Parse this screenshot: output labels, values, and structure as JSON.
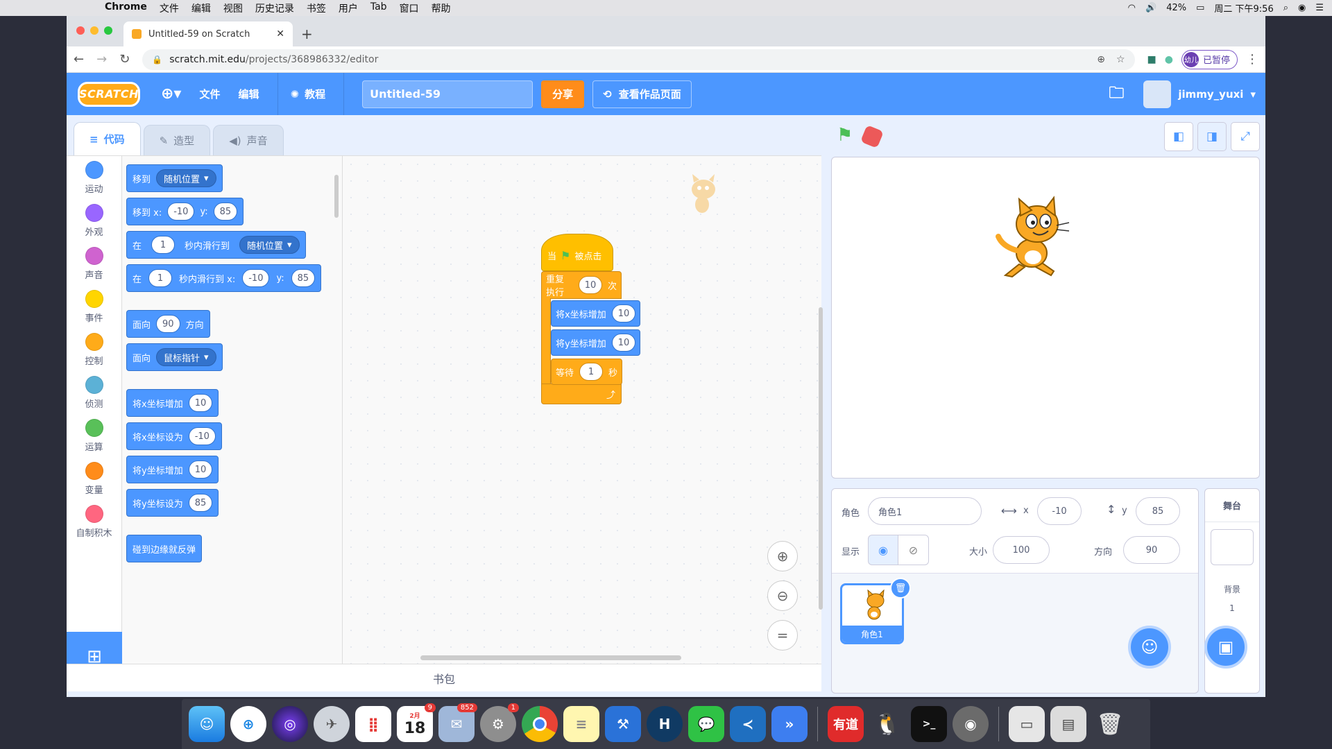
{
  "menubar": {
    "app": "Chrome",
    "items": [
      "文件",
      "编辑",
      "视图",
      "历史记录",
      "书签",
      "用户",
      "Tab",
      "窗口",
      "帮助"
    ],
    "battery": "42%",
    "clock": "周二 下午9:56"
  },
  "browser": {
    "tab_title": "Untitled-59 on Scratch",
    "url_host": "scratch.mit.edu",
    "url_path": "/projects/368986332/editor",
    "paused_label": "已暂停",
    "avatar_text": "幼儿"
  },
  "header": {
    "logo": "SCRATCH",
    "file": "文件",
    "edit": "编辑",
    "tutorials": "教程",
    "project_title": "Untitled-59",
    "share": "分享",
    "see_project": "查看作品页面",
    "username": "jimmy_yuxi"
  },
  "tabs": {
    "code": "代码",
    "costumes": "造型",
    "sounds": "声音"
  },
  "categories": [
    {
      "label": "运动",
      "color": "#4c97ff"
    },
    {
      "label": "外观",
      "color": "#9966ff"
    },
    {
      "label": "声音",
      "color": "#cf63cf"
    },
    {
      "label": "事件",
      "color": "#ffd500"
    },
    {
      "label": "控制",
      "color": "#ffab19"
    },
    {
      "label": "侦测",
      "color": "#5cb1d6"
    },
    {
      "label": "运算",
      "color": "#59c059"
    },
    {
      "label": "变量",
      "color": "#ff8c1a"
    },
    {
      "label": "自制积木",
      "color": "#ff6680"
    }
  ],
  "palette": {
    "goto": "移到",
    "goto_target": "随机位置",
    "gotoxy": "移到 x:",
    "gotoxy_x": "-10",
    "y": "y:",
    "gotoxy_y": "85",
    "glide_in": "在",
    "glide_secs": "1",
    "glide_to": "秒内滑行到",
    "glide_target": "随机位置",
    "glide_to_xy": "秒内滑行到 x:",
    "glide_x": "-10",
    "glide_y": "85",
    "point": "面向",
    "point_dir": "90",
    "point_dir_suffix": "方向",
    "point_towards_target": "鼠标指针",
    "change_x": "将x坐标增加",
    "change_x_val": "10",
    "set_x": "将x坐标设为",
    "set_x_val": "-10",
    "change_y": "将y坐标增加",
    "change_y_val": "10",
    "set_y": "将y坐标设为",
    "set_y_val": "85",
    "bounce": "碰到边缘就反弹"
  },
  "script": {
    "hat_when": "当",
    "hat_clicked": "被点击",
    "repeat": "重复执行",
    "repeat_times": "10",
    "repeat_suffix": "次",
    "change_x": "将x坐标增加",
    "change_x_val": "10",
    "change_y": "将y坐标增加",
    "change_y_val": "10",
    "wait": "等待",
    "wait_val": "1",
    "wait_suffix": "秒"
  },
  "backpack": "书包",
  "sprite_info": {
    "sprite_label": "角色",
    "sprite_name": "角色1",
    "x_label": "x",
    "x_val": "-10",
    "y_label": "y",
    "y_val": "85",
    "show_label": "显示",
    "size_label": "大小",
    "size_val": "100",
    "direction_label": "方向",
    "direction_val": "90"
  },
  "sprites": [
    {
      "name": "角色1"
    }
  ],
  "stage_panel": {
    "title": "舞台",
    "backdrops_label": "背景",
    "backdrops_count": "1"
  },
  "dock": {
    "calendar_month": "2月",
    "calendar_day": "18",
    "calendar_badge": "9",
    "mail_badge": "852",
    "prefs_badge": "1",
    "youdao": "有道"
  },
  "colors": {
    "scratch_blue": "#4c97ff",
    "motion_dark": "#3373cc",
    "events": "#ffbf00",
    "control": "#ffab19",
    "share": "#ff8c1a"
  }
}
